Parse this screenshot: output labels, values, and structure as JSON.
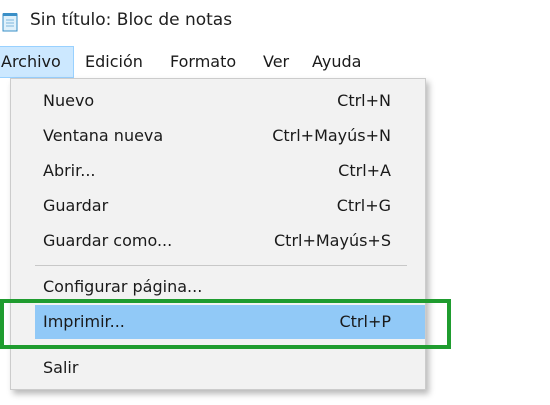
{
  "window": {
    "title": "Sin título: Bloc de notas",
    "icon": "notepad-icon"
  },
  "menubar": {
    "items": [
      {
        "label": "Archivo",
        "active": true
      },
      {
        "label": "Edición"
      },
      {
        "label": "Formato"
      },
      {
        "label": "Ver"
      },
      {
        "label": "Ayuda"
      }
    ]
  },
  "file_menu": {
    "items": [
      {
        "label": "Nuevo",
        "shortcut": "Ctrl+N"
      },
      {
        "label": "Ventana nueva",
        "shortcut": "Ctrl+Mayús+N"
      },
      {
        "label": "Abrir...",
        "shortcut": "Ctrl+A"
      },
      {
        "label": "Guardar",
        "shortcut": "Ctrl+G"
      },
      {
        "label": "Guardar como...",
        "shortcut": "Ctrl+Mayús+S"
      },
      {
        "label": "Configurar página..."
      },
      {
        "label": "Imprimir...",
        "shortcut": "Ctrl+P",
        "highlighted": true
      },
      {
        "label": "Salir"
      }
    ]
  },
  "colors": {
    "highlight": "#91c9f7",
    "annotation_frame": "#1f9c2f",
    "menu_background": "#f2f2f2"
  }
}
